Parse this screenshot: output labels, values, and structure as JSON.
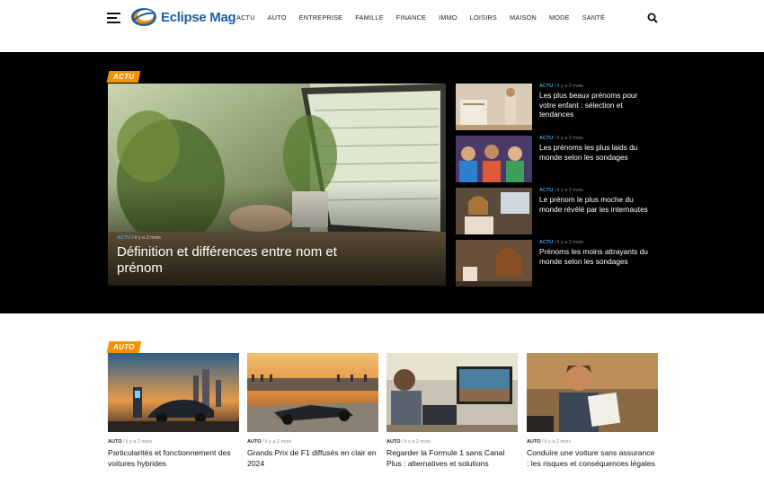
{
  "brand": {
    "name": "Eclipse Mag"
  },
  "nav": [
    "ACTU",
    "AUTO",
    "ENTREPRISE",
    "FAMILLE",
    "FINANCE",
    "IMMO",
    "LOISIRS",
    "MAISON",
    "MODE",
    "SANTÉ"
  ],
  "hero": {
    "section_tag": "ACTU",
    "main": {
      "category": "ACTU",
      "time": "il y a 2 mois",
      "title": "Définition et différences entre nom et prénom"
    },
    "side": [
      {
        "category": "ACTU",
        "time": "il y a 2 mois",
        "title": "Les plus beaux prénoms pour votre enfant : sélection et tendances"
      },
      {
        "category": "ACTU",
        "time": "il y a 2 mois",
        "title": "Les prénoms les plus laids du monde selon les sondages"
      },
      {
        "category": "ACTU",
        "time": "il y a 2 mois",
        "title": "Le prénom le plus moche du monde révélé par les internautes"
      },
      {
        "category": "ACTU",
        "time": "il y a 2 mois",
        "title": "Prénoms les moins attrayants du monde selon les sondages"
      }
    ]
  },
  "auto": {
    "section_tag": "AUTO",
    "cards": [
      {
        "category": "AUTO",
        "time": "il y a 2 mois",
        "title": "Particularités et fonctionnement des voitures hybrides"
      },
      {
        "category": "AUTO",
        "time": "il y a 2 mois",
        "title": "Grands Prix de F1 diffusés en clair en 2024"
      },
      {
        "category": "AUTO",
        "time": "il y a 2 mois",
        "title": "Regarder la Formule 1 sans Canal Plus : alternatives et solutions"
      },
      {
        "category": "AUTO",
        "time": "il y a 2 mois",
        "title": "Conduire une voiture sans assurance : les risques et conséquences légales"
      }
    ]
  },
  "colors": {
    "accent": "#f39200",
    "category_blue": "#3aa0e8",
    "logo_blue": "#1d5fa8"
  }
}
